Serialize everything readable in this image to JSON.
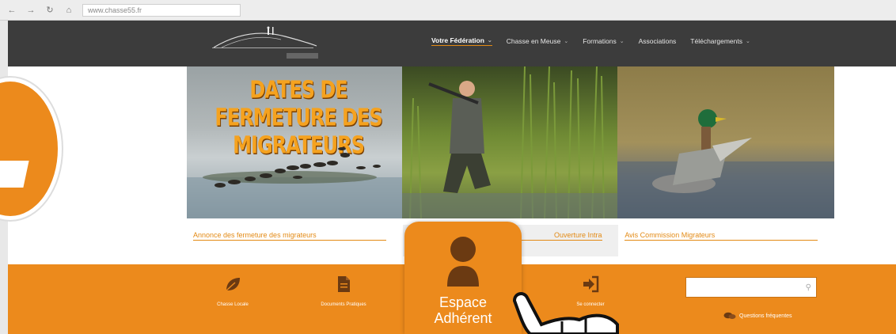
{
  "browser": {
    "url": "www.chasse55.fr"
  },
  "nav": {
    "items": [
      {
        "label": "Votre Fédération",
        "caret": "⌄",
        "active": true
      },
      {
        "label": "Chasse en Meuse",
        "caret": "⌄"
      },
      {
        "label": "Formations",
        "caret": "⌄"
      },
      {
        "label": "Associations",
        "caret": ""
      },
      {
        "label": "Téléchargements",
        "caret": "⌄"
      }
    ]
  },
  "hero": {
    "title": "DATES DE FERMETURE DES MIGRATEURS",
    "captions": [
      "Annonce des fermeture des migrateurs",
      "Ouverture Intra",
      "Avis Commission Migrateurs"
    ]
  },
  "orange_bar": {
    "items": [
      {
        "label": "Chasse Locale",
        "icon": "leaf-icon"
      },
      {
        "label": "Documents Pratiques",
        "icon": "document-icon"
      },
      {
        "label": "Se connecter",
        "icon": "sign-in-icon"
      }
    ],
    "search_placeholder": "",
    "faq_label": "Questions fréquentes"
  },
  "callout": {
    "line1": "Espace",
    "line2": "Adhérent"
  },
  "colors": {
    "accent": "#ec8a1c",
    "header": "#3c3c3c"
  }
}
